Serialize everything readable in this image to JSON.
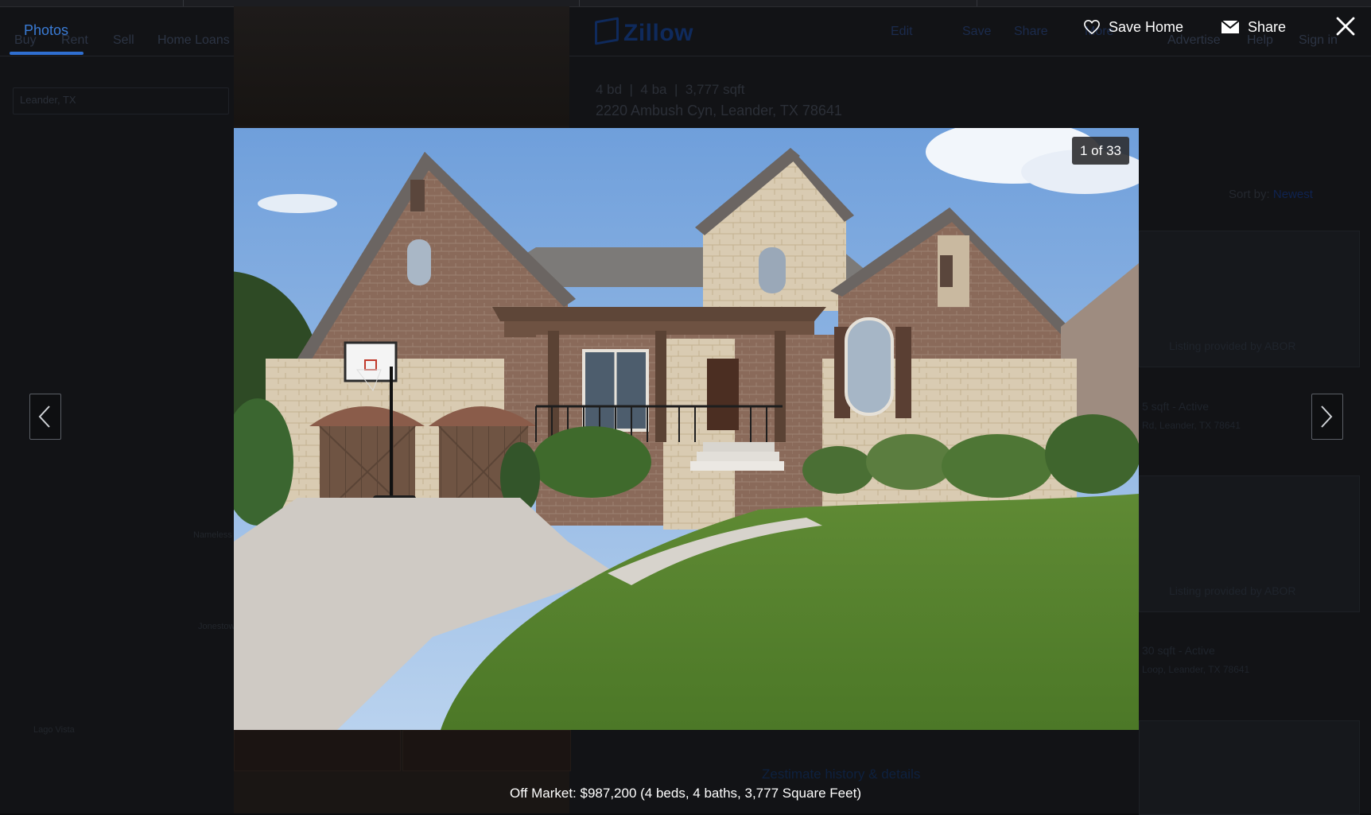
{
  "background": {
    "nav": [
      "Buy",
      "Rent",
      "Sell",
      "Home Loans"
    ],
    "logo": "Zillow",
    "actions": {
      "edit": "Edit",
      "save": "Save",
      "share": "Share",
      "more": "More"
    },
    "right_nav": [
      "Advertise",
      "Help",
      "Sign in"
    ],
    "search_value": "Leander, TX",
    "facts": {
      "beds": "4 bd",
      "baths": "4 ba",
      "sqft": "3,777 sqft"
    },
    "address": "2220 Ambush Cyn, Leander, TX 78641",
    "sort": {
      "label": "Sort by:",
      "value": "Newest"
    },
    "cards": [
      {
        "badge": "Listing provided by ABOR",
        "status": "5 sqft - Active",
        "address": "Rd, Leander, TX 78641"
      },
      {
        "badge": "Listing provided by ABOR",
        "status": "30 sqft - Active",
        "address": "Loop, Leander, TX 78641"
      }
    ],
    "zestimate_link": "Zestimate history & details",
    "map_labels": [
      "Lago Vista",
      "Nameless",
      "Jonestown"
    ]
  },
  "viewer": {
    "tab_label": "Photos",
    "save_home_label": "Save Home",
    "share_label": "Share",
    "counter": "1 of 33",
    "caption": "Off Market: $987,200 (4 beds, 4 baths, 3,777 Square Feet)",
    "colors": {
      "accent": "#2f6fd1",
      "overlay": "#0b0c0e"
    }
  }
}
